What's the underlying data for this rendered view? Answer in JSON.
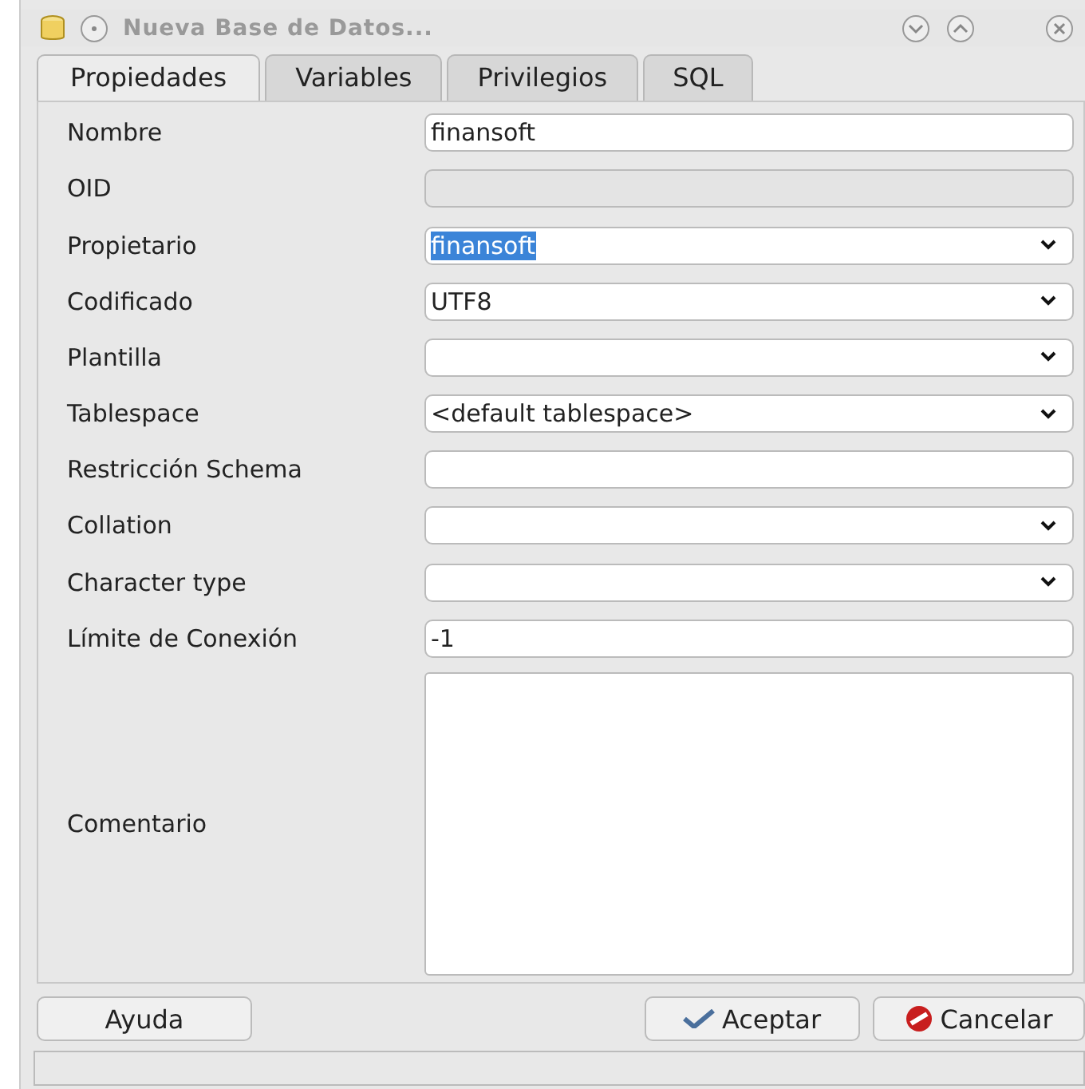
{
  "window": {
    "title": "Nueva Base de Datos..."
  },
  "tabs": [
    {
      "label": "Propiedades",
      "selected": true
    },
    {
      "label": "Variables",
      "selected": false
    },
    {
      "label": "Privilegios",
      "selected": false
    },
    {
      "label": "SQL",
      "selected": false
    }
  ],
  "fields": [
    {
      "label": "Nombre",
      "kind": "text",
      "value": "finansoft",
      "highlighted": false
    },
    {
      "label": "OID",
      "kind": "disabled"
    },
    {
      "label": "Propietario",
      "kind": "combo",
      "value": "finansoft",
      "highlighted": true
    },
    {
      "label": "Codificado",
      "kind": "combo",
      "value": "UTF8",
      "highlighted": false
    },
    {
      "label": "Plantilla",
      "kind": "combo"
    },
    {
      "label": "Tablespace",
      "kind": "combo",
      "value": "<default tablespace>",
      "highlighted": false
    },
    {
      "label": "Restricción Schema",
      "kind": "text"
    },
    {
      "label": "Collation",
      "kind": "combo"
    },
    {
      "label": "Character type",
      "kind": "combo"
    },
    {
      "label": "Límite de Conexión",
      "kind": "text",
      "value": "-1",
      "highlighted": false
    },
    {
      "label": "Comentario",
      "kind": "textarea"
    }
  ],
  "buttons": [
    {
      "label": "Ayuda",
      "kind": "help"
    },
    {
      "label": "Aceptar",
      "kind": "ok"
    },
    {
      "label": "Cancelar",
      "kind": "cancel"
    }
  ]
}
